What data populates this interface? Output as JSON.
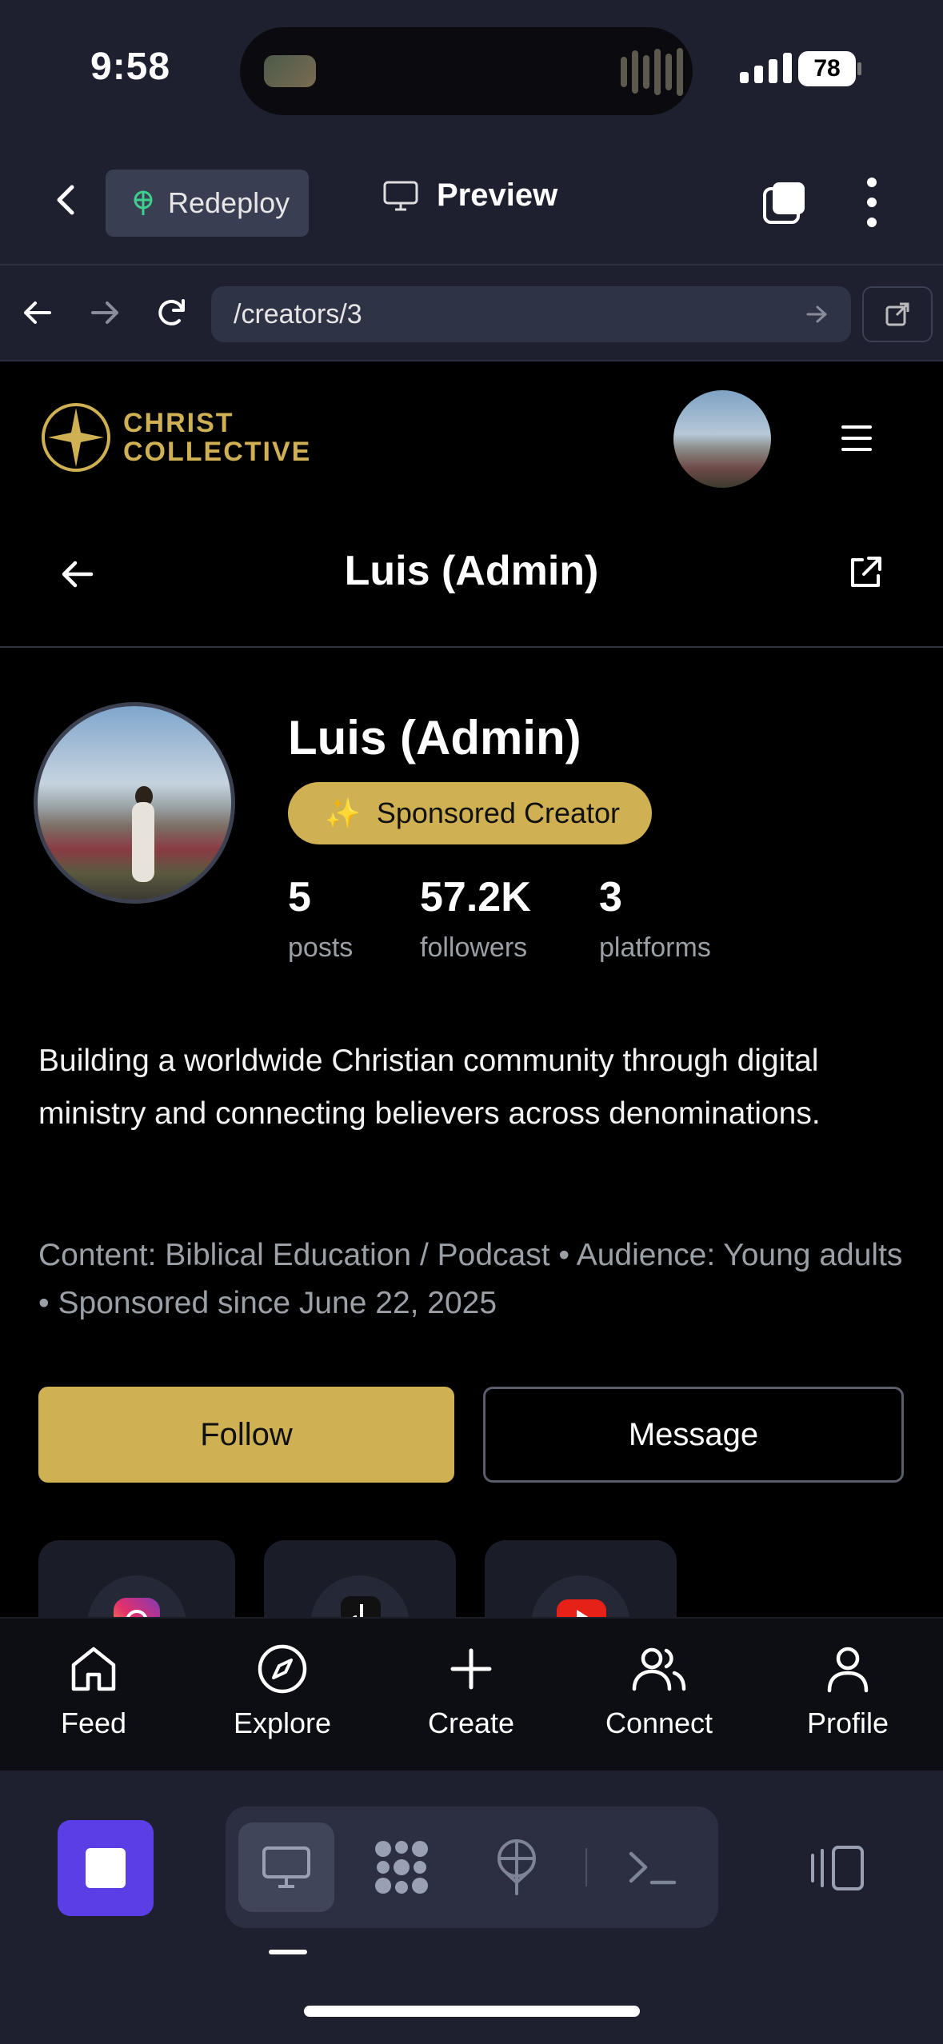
{
  "status_bar": {
    "time": "9:58",
    "battery": "78"
  },
  "top_bar": {
    "redeploy_label": "Redeploy",
    "preview_label": "Preview"
  },
  "url_bar": {
    "path": "/creators/3"
  },
  "brand": {
    "line1": "CHRIST",
    "line2": "COLLECTIVE",
    "accent": "#cfb053"
  },
  "page_header": {
    "title": "Luis (Admin)"
  },
  "profile": {
    "name": "Luis (Admin)",
    "badge_icon": "✨",
    "badge_label": "Sponsored Creator",
    "stats": [
      {
        "value": "5",
        "label": "posts"
      },
      {
        "value": "57.2K",
        "label": "followers"
      },
      {
        "value": "3",
        "label": "platforms"
      }
    ],
    "bio": "Building a worldwide Christian community through digital ministry and connecting believers across denominations.",
    "meta": "Content: Biblical Education / Podcast • Audience: Young adults • Sponsored since June 22, 2025",
    "follow_label": "Follow",
    "message_label": "Message",
    "platforms": [
      "instagram-icon",
      "tiktok-icon",
      "youtube-icon"
    ]
  },
  "app_nav": [
    {
      "label": "Feed",
      "icon": "home-icon"
    },
    {
      "label": "Explore",
      "icon": "compass-icon"
    },
    {
      "label": "Create",
      "icon": "plus-icon"
    },
    {
      "label": "Connect",
      "icon": "users-icon"
    },
    {
      "label": "Profile",
      "icon": "user-icon"
    }
  ],
  "toolbar": {
    "items": [
      "stop-icon",
      "monitor-icon",
      "apps-grid-icon",
      "deploy-icon",
      "terminal-icon",
      "panels-icon"
    ]
  }
}
